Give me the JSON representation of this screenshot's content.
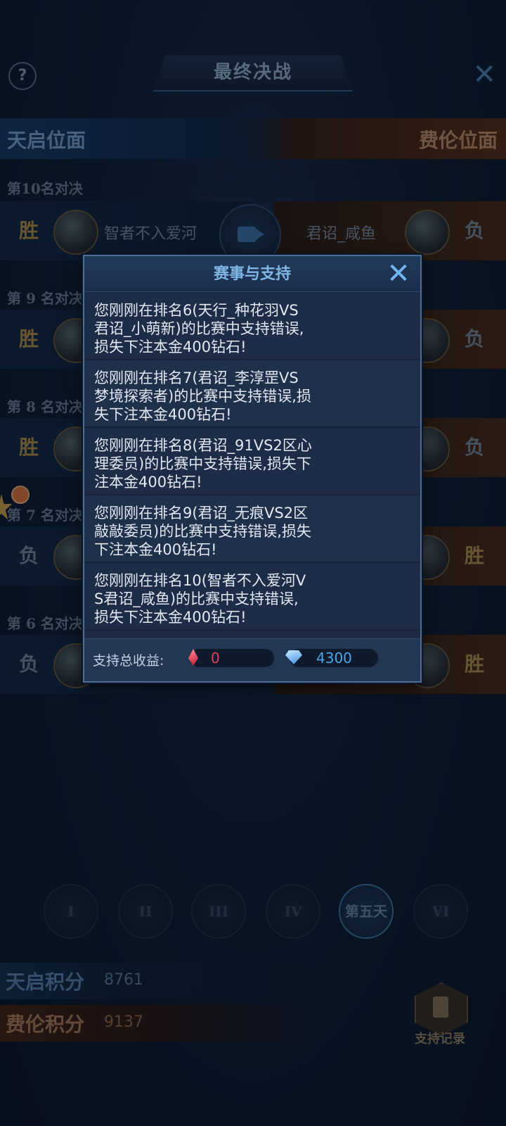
{
  "header": {
    "title": "最终决战",
    "help_icon": "question-icon",
    "close_icon": "close-icon"
  },
  "factions": {
    "left": "天启位面",
    "right": "费伦位面"
  },
  "matches": [
    {
      "label": "第10名对决",
      "left_result": "胜",
      "left_name": "智者不入爱河",
      "right_name": "君诏_咸鱼",
      "right_result": "负"
    },
    {
      "label": "第 9 名对决",
      "left_result": "胜",
      "right_result": "负"
    },
    {
      "label": "第 8 名对决",
      "left_result": "胜",
      "right_result": "负"
    },
    {
      "label": "第 7 名对决",
      "left_result": "负",
      "right_result": "胜"
    },
    {
      "label": "第 6 名对决",
      "left_result": "负",
      "right_result": "胜"
    }
  ],
  "days": [
    "I",
    "II",
    "III",
    "IV",
    "第五天",
    "VI"
  ],
  "scores": {
    "a_label": "天启积分",
    "a_value": "8761",
    "b_label": "费伦积分",
    "b_value": "9137"
  },
  "record_button": "支持记录",
  "dialog": {
    "title": "赛事与支持",
    "messages": [
      "您刚刚在排名6(天行_种花羽VS君诏_小萌新)的比赛中支持错误,损失下注本金400钻石!",
      "您刚刚在排名7(君诏_李淳罡VS梦境探索者)的比赛中支持错误,损失下注本金400钻石!",
      "您刚刚在排名8(君诏_91VS2区心理委员)的比赛中支持错误,损失下注本金400钻石!",
      "您刚刚在排名9(君诏_无痕VS2区敲敲委员)的比赛中支持错误,损失下注本金400钻石!",
      "您刚刚在排名10(智者不入爱河VS君诏_咸鱼)的比赛中支持错误,损失下注本金400钻石!"
    ],
    "footer_label": "支持总收益:",
    "red_value": "0",
    "blue_value": "4300"
  },
  "colors": {
    "accent": "#7fb6e6",
    "win": "#b8934a",
    "red_gem": "#e0425a",
    "blue_gem": "#4ea4e8"
  }
}
